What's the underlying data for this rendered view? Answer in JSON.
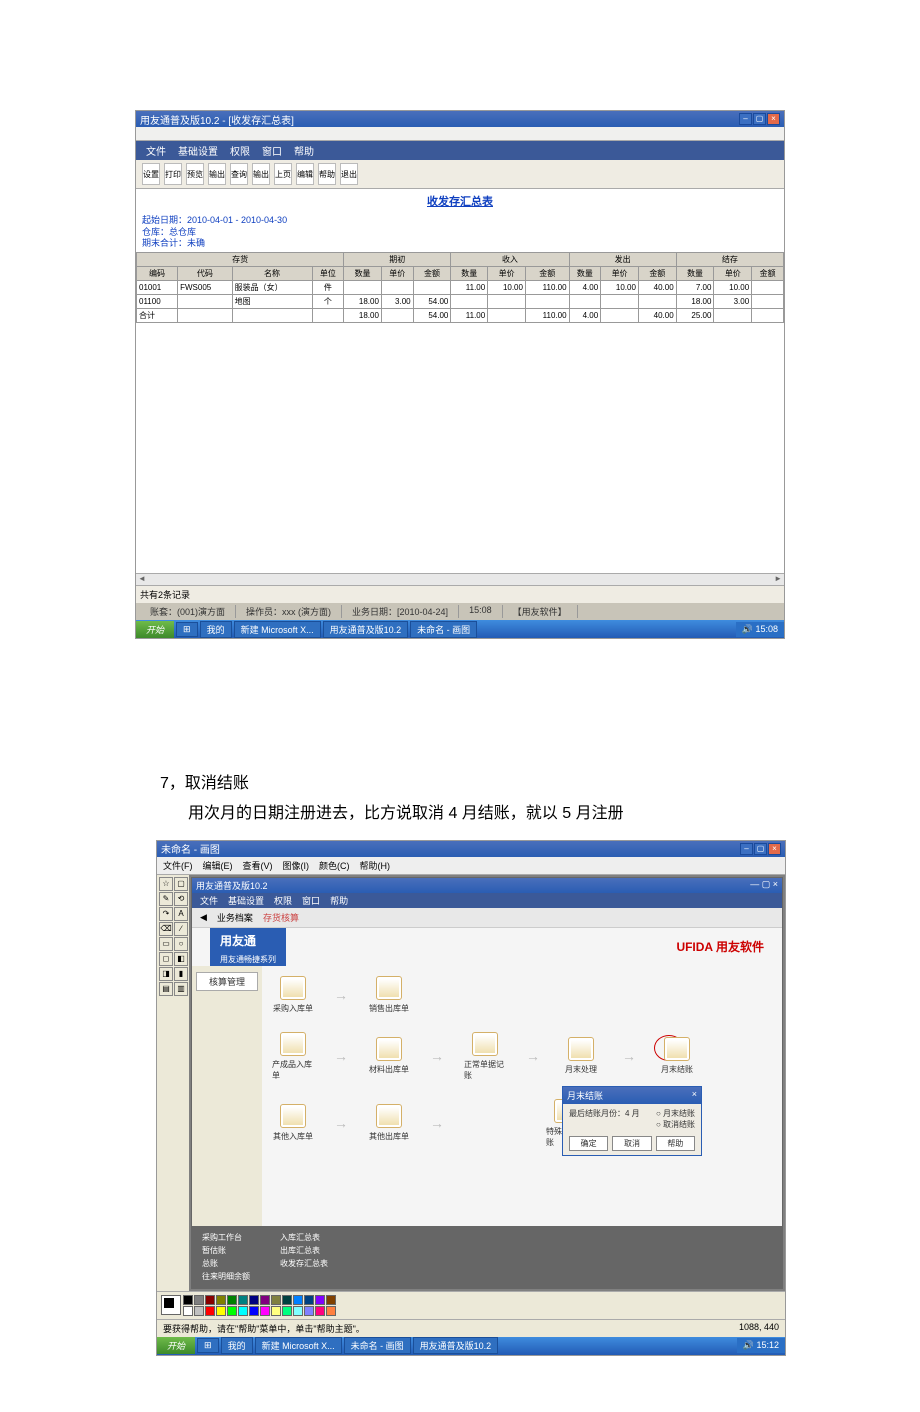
{
  "doc_text": {
    "item_num": "7，",
    "item_title": "取消结账",
    "item_desc": "用次月的日期注册进去，比方说取消 4 月结账，就以 5 月注册"
  },
  "screenshot1": {
    "title": "用友通普及版10.2 - [收发存汇总表]",
    "menu": [
      "文件",
      "基础设置",
      "权限",
      "窗口",
      "帮助"
    ],
    "toolbar": [
      "设置",
      "打印",
      "预览",
      "输出",
      "查询",
      "输出",
      "上页",
      "编辑",
      "帮助",
      "退出"
    ],
    "report_title": "收发存汇总表",
    "meta_line1": "起始日期：2010-04-01 - 2010-04-30",
    "meta_line2": "仓库：总仓库",
    "meta_line3": "期末合计：未确",
    "group_headers": [
      "存货",
      "期初",
      "收入",
      "发出",
      "结存"
    ],
    "col_headers": [
      "编码",
      "代码",
      "名称",
      "单位",
      "数量",
      "单价",
      "金额",
      "数量",
      "单价",
      "金额",
      "数量",
      "单价",
      "金额",
      "数量",
      "单价",
      "金额"
    ],
    "rows": [
      {
        "code": "01001",
        "alt": "FWS005",
        "name": "服装品（女）",
        "unit": "件",
        "qc_qty": "",
        "qc_prc": "",
        "qc_amt": "",
        "sr_qty": "11.00",
        "sr_prc": "10.00",
        "sr_amt": "110.00",
        "fc_qty": "4.00",
        "fc_prc": "10.00",
        "fc_amt": "40.00",
        "jc_qty": "7.00",
        "jc_prc": "10.00",
        "jc_amt": ""
      },
      {
        "code": "01100",
        "alt": "",
        "name": "地图",
        "unit": "个",
        "qc_qty": "18.00",
        "qc_prc": "3.00",
        "qc_amt": "54.00",
        "sr_qty": "",
        "sr_prc": "",
        "sr_amt": "",
        "fc_qty": "",
        "fc_prc": "",
        "fc_amt": "",
        "jc_qty": "18.00",
        "jc_prc": "3.00",
        "jc_amt": ""
      },
      {
        "code": "合计",
        "alt": "",
        "name": "",
        "unit": "",
        "qc_qty": "18.00",
        "qc_prc": "",
        "qc_amt": "54.00",
        "sr_qty": "11.00",
        "sr_prc": "",
        "sr_amt": "110.00",
        "fc_qty": "4.00",
        "fc_prc": "",
        "fc_amt": "40.00",
        "jc_qty": "25.00",
        "jc_prc": "",
        "jc_amt": ""
      }
    ],
    "record_bar": "共有2条记录",
    "status": {
      "acct": "账套：(001)演方面",
      "oper": "操作员：xxx (演方面)",
      "bdate": "业务日期：[2010-04-24]",
      "time": "15:08",
      "util": "【用友软件】"
    },
    "taskbar": {
      "start": "开始",
      "items": [
        "",
        "我的",
        "新建 Microsoft X...",
        "用友通普及版10.2",
        "未命名 - 画图"
      ],
      "tray": "15:08"
    }
  },
  "screenshot2": {
    "paint_title": "未命名 - 画图",
    "paint_menu": [
      "文件(F)",
      "编辑(E)",
      "查看(V)",
      "图像(I)",
      "颜色(C)",
      "帮助(H)"
    ],
    "tool_icons": [
      "☆",
      "▢",
      "✎",
      "⟲",
      "↷",
      "A",
      "⌫",
      "∕",
      "▭",
      "○",
      "◻",
      "◧",
      "◨",
      "▮",
      "▤",
      "▥"
    ],
    "inner_title": "用友通普及版10.2",
    "inner_menu": [
      "文件",
      "基础设置",
      "权限",
      "窗口",
      "帮助"
    ],
    "inner_tabs": {
      "t1": "业务档案",
      "t2": "存货核算"
    },
    "brand": {
      "logo": "用友通",
      "tag": "用友通畅捷系列",
      "ufida": "UFIDA 用友软件"
    },
    "side": {
      "box": "核算管理"
    },
    "flow": {
      "r1": [
        "采购入库单",
        "销售出库单"
      ],
      "r2": [
        "产成品入库单",
        "材料出库单",
        "正常单据记账",
        "月末处理",
        "月末结账"
      ],
      "r3": [
        "其他入库单",
        "其他出库单",
        "特殊单据记账"
      ]
    },
    "dialog": {
      "title": "月末结账",
      "label": "最后结账月份：4 月",
      "opts": [
        "月末结账",
        "取消结账"
      ],
      "btns": [
        "确定",
        "取消",
        "帮助"
      ]
    },
    "links": {
      "c1": [
        "采购工作台",
        "暂估账",
        "总账",
        "往来明细余额"
      ],
      "c2": [
        "入库汇总表",
        "出库汇总表",
        "收发存汇总表"
      ]
    },
    "palette": [
      "#000",
      "#808080",
      "#800",
      "#808000",
      "#008000",
      "#008080",
      "#000080",
      "#800080",
      "#808040",
      "#004040",
      "#0080ff",
      "#004080",
      "#8000ff",
      "#804000",
      "#fff",
      "#c0c0c0",
      "#f00",
      "#ff0",
      "#0f0",
      "#0ff",
      "#00f",
      "#f0f",
      "#ffff80",
      "#00ff80",
      "#80ffff",
      "#8080ff",
      "#ff0080",
      "#ff8040"
    ],
    "paint_status": {
      "left": "要获得帮助，请在\"帮助\"菜单中，单击\"帮助主题\"。",
      "right": "1088, 440"
    },
    "taskbar": {
      "start": "开始",
      "items": [
        "",
        "我的",
        "新建 Microsoft X...",
        "未命名 - 画图",
        "用友通普及版10.2"
      ],
      "tray": "15:12"
    }
  }
}
